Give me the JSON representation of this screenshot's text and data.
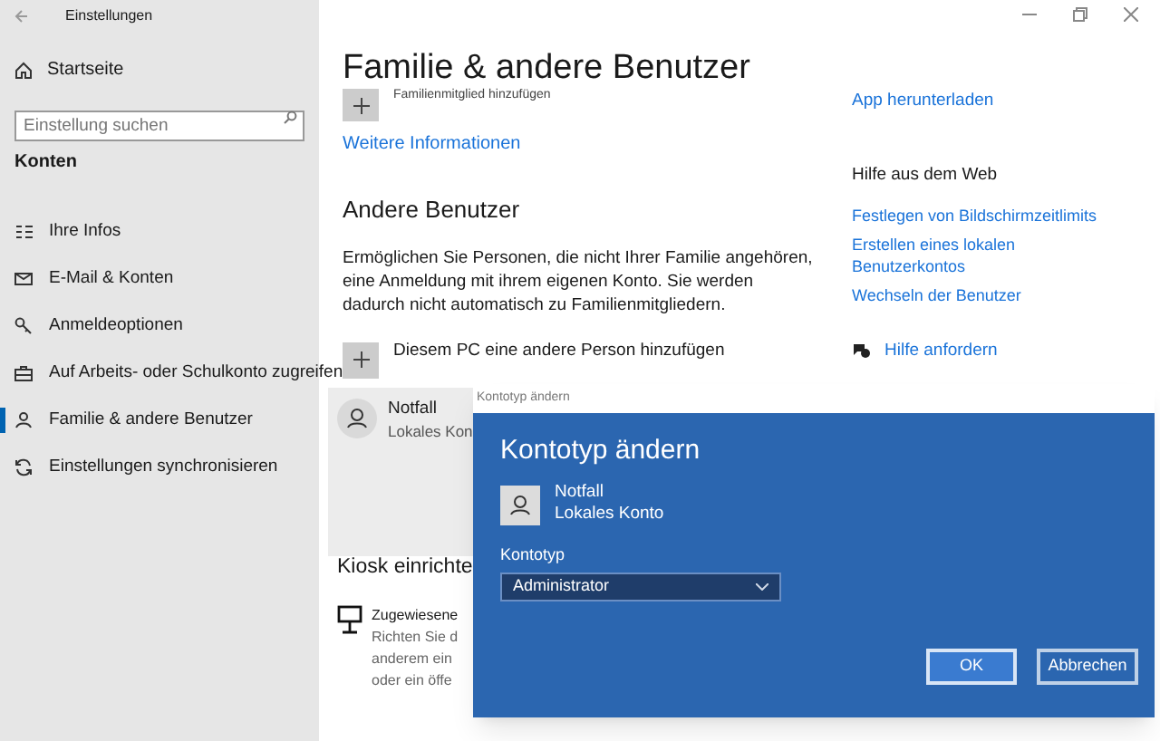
{
  "window": {
    "title": "Einstellungen"
  },
  "sidebar": {
    "home": "Startseite",
    "search": {
      "placeholder": "Einstellung suchen"
    },
    "section": "Konten",
    "items": [
      {
        "label": "Ihre Infos",
        "selected": false
      },
      {
        "label": "E-Mail & Konten",
        "selected": false
      },
      {
        "label": "Anmeldeoptionen",
        "selected": false
      },
      {
        "label": "Auf Arbeits- oder Schulkonto zugreifen",
        "selected": false
      },
      {
        "label": "Familie & andere Benutzer",
        "selected": true
      },
      {
        "label": "Einstellungen synchronisieren",
        "selected": false
      }
    ]
  },
  "page": {
    "title": "Familie & andere Benutzer",
    "add_family": "Familienmitglied hinzufügen",
    "more_info": "Weitere Informationen",
    "other_users_heading": "Andere Benutzer",
    "other_users_text": "Ermöglichen Sie Personen, die nicht Ihrer Familie angehören, eine Anmeldung mit ihrem eigenen Konto. Sie werden dadurch nicht automatisch zu Familienmitgliedern.",
    "add_other": "Diesem PC eine andere Person hinzufügen",
    "user": {
      "name": "Notfall",
      "type": "Lokales Kon"
    },
    "kiosk_heading": "Kiosk einrichte",
    "kiosk_title": "Zugewiesene",
    "kiosk_lines": [
      "Richten Sie d",
      "anderem ein",
      "oder ein öffe"
    ]
  },
  "right": {
    "download": "App herunterladen",
    "help_heading": "Hilfe aus dem Web",
    "links": [
      "Festlegen von Bildschirmzeitlimits",
      "Erstellen eines lokalen Benutzerkontos",
      "Wechseln der Benutzer"
    ],
    "get_help": "Hilfe anfordern"
  },
  "dialog": {
    "title_bar": "Kontotyp ändern",
    "heading": "Kontotyp ändern",
    "user_name": "Notfall",
    "user_type": "Lokales Konto",
    "field_label": "Kontotyp",
    "value": "Administrator",
    "buttons": [
      {
        "label": "OK",
        "primary": true
      },
      {
        "label": "Abbrechen",
        "primary": false
      }
    ]
  }
}
